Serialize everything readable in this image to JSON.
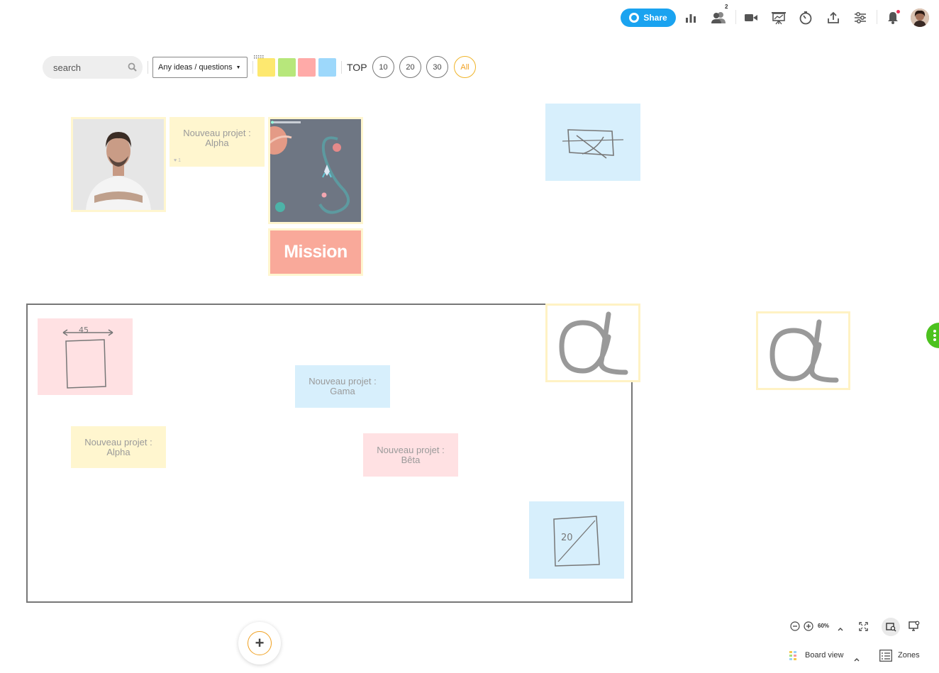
{
  "toolbar": {
    "share_label": "Share",
    "participants_count": "2",
    "icons": [
      "globe-icon",
      "stats-icon",
      "participants-icon",
      "video-icon",
      "presentation-icon",
      "timer-icon",
      "export-icon",
      "settings-icon",
      "bell-icon",
      "user-avatar"
    ]
  },
  "filters": {
    "search_placeholder": "search",
    "select_value": "Any ideas / questions",
    "color_swatches": [
      "#fde86f",
      "#b7e77b",
      "#ffaaa8",
      "#9dd8fb"
    ],
    "top_label": "TOP",
    "top_options": [
      "10",
      "20",
      "30",
      "All"
    ],
    "top_selected": "All"
  },
  "board": {
    "notes": {
      "alpha_top": "Nouveau projet :\nAlpha",
      "alpha_top_likes": "1",
      "mission_text": "Mission",
      "gama": "Nouveau projet :\nGama",
      "alpha_bottom": "Nouveau projet :\nAlpha",
      "beta": "Nouveau projet :\nBêta",
      "sketch_number_1": "45",
      "sketch_number_2": "20"
    },
    "colors": {
      "yellow_note": "#fff6cf",
      "pink_note": "#ffe1e3",
      "blue_note": "#d7effc",
      "accent": "#f0a020",
      "share_blue": "#1aa3f0",
      "side_handle_green": "#4cc21f"
    }
  },
  "bottom": {
    "zoom_value": "60%",
    "board_view_label": "Board view",
    "zones_label": "Zones"
  }
}
